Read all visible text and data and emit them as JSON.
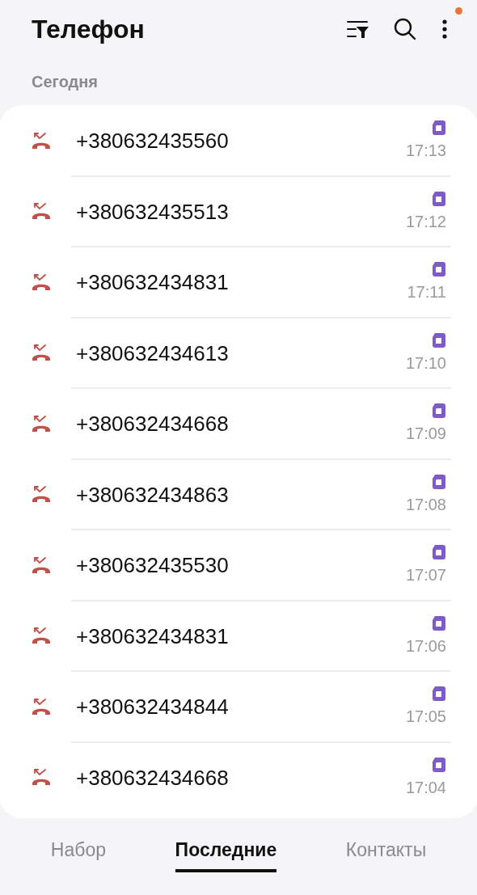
{
  "app_bar": {
    "title": "Телефон"
  },
  "section": {
    "label": "Сегодня"
  },
  "calls": [
    {
      "kind": "missed",
      "number": "+380632435560",
      "time": "17:13"
    },
    {
      "kind": "missed",
      "number": "+380632435513",
      "time": "17:12"
    },
    {
      "kind": "missed",
      "number": "+380632434831",
      "time": "17:11"
    },
    {
      "kind": "missed",
      "number": "+380632434613",
      "time": "17:10"
    },
    {
      "kind": "missed",
      "number": "+380632434668",
      "time": "17:09"
    },
    {
      "kind": "missed",
      "number": "+380632434863",
      "time": "17:08"
    },
    {
      "kind": "missed",
      "number": "+380632435530",
      "time": "17:07"
    },
    {
      "kind": "missed",
      "number": "+380632434831",
      "time": "17:06"
    },
    {
      "kind": "missed",
      "number": "+380632434844",
      "time": "17:05"
    },
    {
      "kind": "missed",
      "number": "+380632434668",
      "time": "17:04"
    }
  ],
  "tabs": [
    {
      "label": "Набор",
      "selected": false
    },
    {
      "label": "Последние",
      "selected": true
    },
    {
      "label": "Контакты",
      "selected": false
    }
  ]
}
